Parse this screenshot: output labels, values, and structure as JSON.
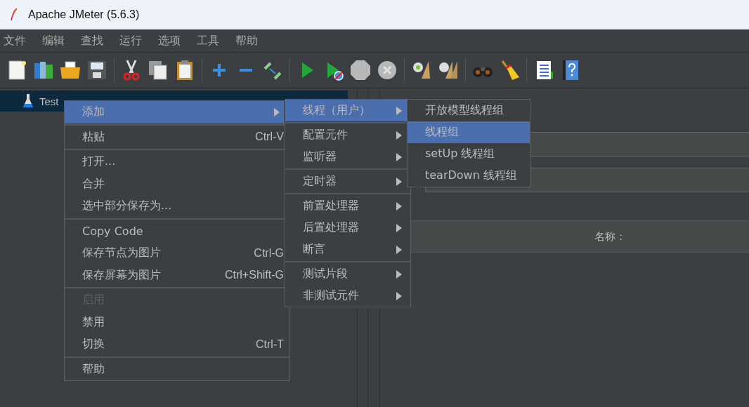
{
  "window": {
    "title": "Apache JMeter (5.6.3)"
  },
  "menu_bar": [
    "文件",
    "编辑",
    "查找",
    "运行",
    "选项",
    "工具",
    "帮助"
  ],
  "tree": {
    "items": [
      {
        "label": "Test",
        "selected": true
      }
    ]
  },
  "table": {
    "columns": [
      "名称："
    ]
  },
  "context_menu": {
    "groups": [
      [
        {
          "label": "添加",
          "selected": true,
          "disabled": false,
          "has_submenu": true
        }
      ],
      [
        {
          "label": "粘贴",
          "shortcut": "Ctrl-V",
          "selected": false,
          "disabled": false,
          "has_submenu": false
        }
      ],
      [
        {
          "label": "打开...",
          "selected": false,
          "disabled": false,
          "has_submenu": false
        },
        {
          "label": "合并",
          "selected": false,
          "disabled": false,
          "has_submenu": false
        },
        {
          "label": "选中部分保存为...",
          "selected": false,
          "disabled": false,
          "has_submenu": false
        }
      ],
      [
        {
          "label": "Copy Code",
          "selected": false,
          "disabled": false,
          "has_submenu": false
        },
        {
          "label": "保存节点为图片",
          "shortcut": "Ctrl-G",
          "selected": false,
          "disabled": false,
          "has_submenu": false
        },
        {
          "label": "保存屏幕为图片",
          "shortcut": "Ctrl+Shift-G",
          "selected": false,
          "disabled": false,
          "has_submenu": false
        }
      ],
      [
        {
          "label": "启用",
          "selected": false,
          "disabled": true,
          "has_submenu": false
        },
        {
          "label": "禁用",
          "selected": false,
          "disabled": false,
          "has_submenu": false
        },
        {
          "label": "切换",
          "shortcut": "Ctrl-T",
          "selected": false,
          "disabled": false,
          "has_submenu": false
        }
      ],
      [
        {
          "label": "帮助",
          "selected": false,
          "disabled": false,
          "has_submenu": false
        }
      ]
    ]
  },
  "add_submenu": {
    "groups": [
      [
        {
          "label": "线程（用户）",
          "selected": true,
          "has_submenu": true
        }
      ],
      [
        {
          "label": "配置元件",
          "selected": false,
          "has_submenu": true
        },
        {
          "label": "监听器",
          "selected": false,
          "has_submenu": true
        }
      ],
      [
        {
          "label": "定时器",
          "selected": false,
          "has_submenu": true
        }
      ],
      [
        {
          "label": "前置处理器",
          "selected": false,
          "has_submenu": true
        },
        {
          "label": "后置处理器",
          "selected": false,
          "has_submenu": true
        },
        {
          "label": "断言",
          "selected": false,
          "has_submenu": true
        }
      ],
      [
        {
          "label": "测试片段",
          "selected": false,
          "has_submenu": true
        },
        {
          "label": "非测试元件",
          "selected": false,
          "has_submenu": true
        }
      ]
    ]
  },
  "thread_submenu": {
    "items": [
      {
        "label": "开放模型线程组",
        "selected": false
      },
      {
        "label": "线程组",
        "selected": true
      },
      {
        "label": "setUp 线程组",
        "selected": false
      },
      {
        "label": "tearDown 线程组",
        "selected": false
      }
    ]
  }
}
